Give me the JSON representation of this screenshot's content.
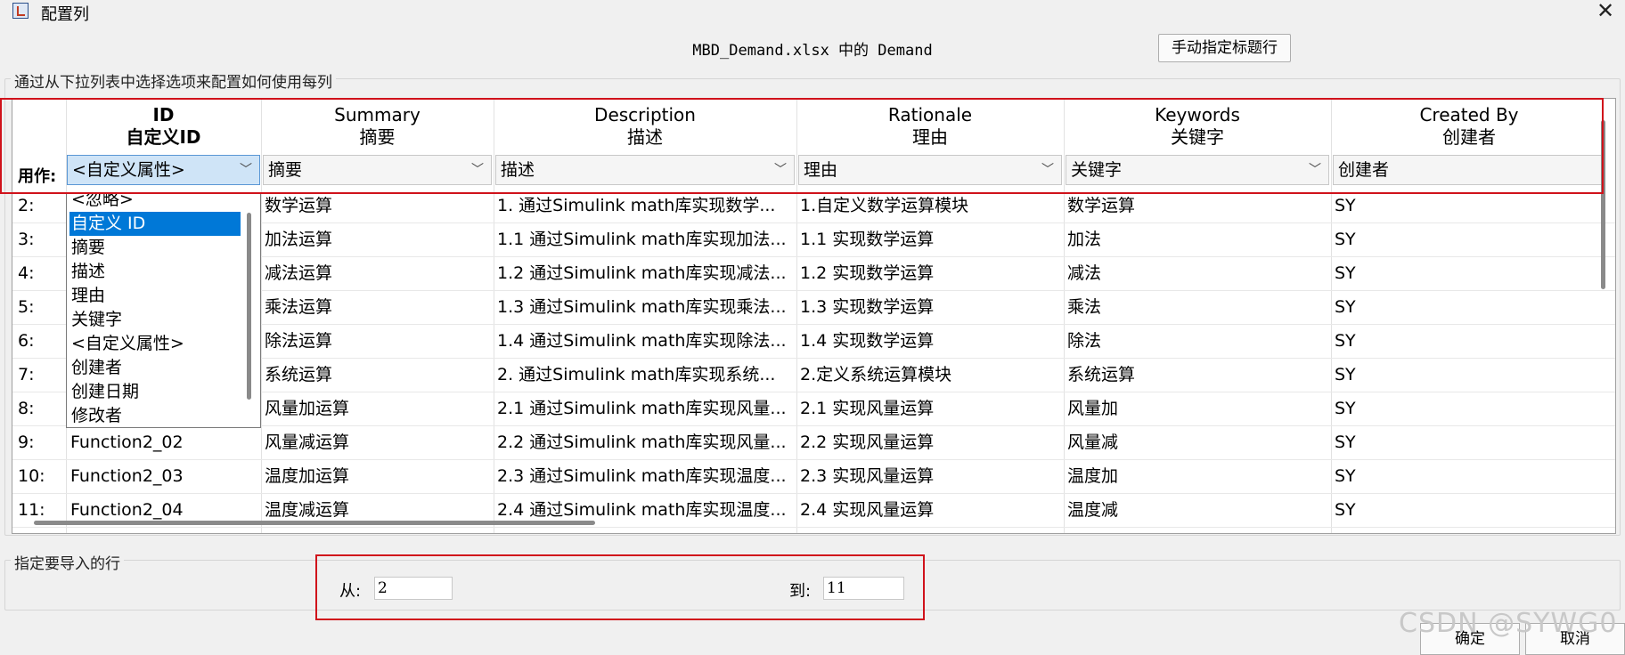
{
  "window": {
    "title": "配置列",
    "close_glyph": "✕"
  },
  "header": {
    "file_title": "MBD_Demand.xlsx 中的 Demand",
    "manual_header_button": "手动指定标题行"
  },
  "columns_group": {
    "label": "通过从下拉列表中选择选项来配置如何使用每列"
  },
  "table": {
    "use_as_label": "用作:",
    "columns": [
      {
        "en": "ID",
        "cn": "自定义ID",
        "use_as": "<自定义属性>"
      },
      {
        "en": "Summary",
        "cn": "摘要",
        "use_as": "摘要"
      },
      {
        "en": "Description",
        "cn": "描述",
        "use_as": "描述"
      },
      {
        "en": "Rationale",
        "cn": "理由",
        "use_as": "理由"
      },
      {
        "en": "Keywords",
        "cn": "关键字",
        "use_as": "关键字"
      },
      {
        "en": "Created By",
        "cn": "创建者",
        "use_as": "创建者"
      }
    ],
    "rows": [
      {
        "num": "2:",
        "id": "",
        "summary": "数学运算",
        "description": "1. 通过Simulink math库实现数学...",
        "rationale": "1.自定义数学运算模块",
        "keywords": "数学运算",
        "created_by": "SY"
      },
      {
        "num": "3:",
        "id": "",
        "summary": "加法运算",
        "description": "1.1 通过Simulink math库实现加法...",
        "rationale": "1.1 实现数学运算",
        "keywords": "加法",
        "created_by": "SY"
      },
      {
        "num": "4:",
        "id": "",
        "summary": "减法运算",
        "description": "1.2 通过Simulink math库实现减法...",
        "rationale": "1.2 实现数学运算",
        "keywords": "减法",
        "created_by": "SY"
      },
      {
        "num": "5:",
        "id": "",
        "summary": "乘法运算",
        "description": "1.3 通过Simulink math库实现乘法...",
        "rationale": "1.3 实现数学运算",
        "keywords": "乘法",
        "created_by": "SY"
      },
      {
        "num": "6:",
        "id": "",
        "summary": "除法运算",
        "description": "1.4 通过Simulink math库实现除法...",
        "rationale": "1.4 实现数学运算",
        "keywords": "除法",
        "created_by": "SY"
      },
      {
        "num": "7:",
        "id": "",
        "summary": "系统运算",
        "description": "2. 通过Simulink math库实现系统...",
        "rationale": "2.定义系统运算模块",
        "keywords": "系统运算",
        "created_by": "SY"
      },
      {
        "num": "8:",
        "id": "",
        "summary": "风量加运算",
        "description": "2.1 通过Simulink math库实现风量...",
        "rationale": "2.1 实现风量运算",
        "keywords": "风量加",
        "created_by": "SY"
      },
      {
        "num": "9:",
        "id": "Function2_02",
        "summary": "风量减运算",
        "description": "2.2 通过Simulink math库实现风量...",
        "rationale": "2.2 实现风量运算",
        "keywords": "风量减",
        "created_by": "SY"
      },
      {
        "num": "10:",
        "id": "Function2_03",
        "summary": "温度加运算",
        "description": "2.3 通过Simulink math库实现温度...",
        "rationale": "2.3 实现风量运算",
        "keywords": "温度加",
        "created_by": "SY"
      },
      {
        "num": "11:",
        "id": "Function2_04",
        "summary": "温度减运算",
        "description": "2.4 通过Simulink math库实现温度...",
        "rationale": "2.4 实现风量运算",
        "keywords": "温度减",
        "created_by": "SY"
      }
    ]
  },
  "dropdown": {
    "items": [
      "<忽略>",
      "自定义 ID",
      "摘要",
      "描述",
      "理由",
      "关键字",
      "<自定义属性>",
      "创建者",
      "创建日期",
      "修改者"
    ],
    "selected_index": 1
  },
  "rows_group": {
    "label": "指定要导入的行",
    "from_label": "从:",
    "from_value": "2",
    "to_label": "到:",
    "to_value": "11"
  },
  "buttons": {
    "ok": "确定",
    "cancel": "取消"
  },
  "watermark": "CSDN @SYWG0",
  "colors": {
    "highlight_red": "#d0121b",
    "selection_blue": "#0078d7",
    "combo_active": "#cfe4f7"
  }
}
